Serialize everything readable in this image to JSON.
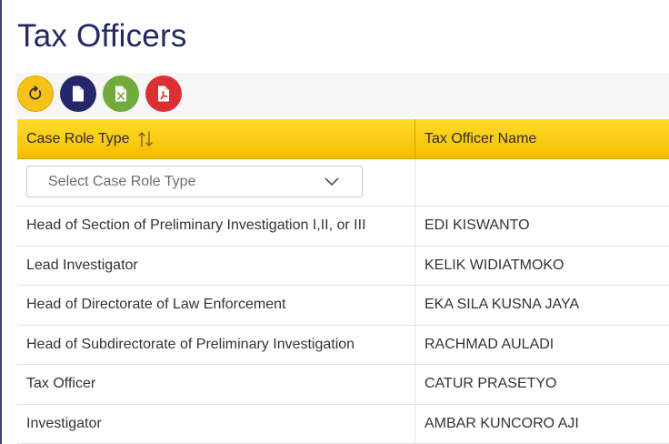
{
  "page": {
    "title": "Tax Officers"
  },
  "toolbar": {
    "buttons": [
      {
        "name": "refresh",
        "icon": "refresh-icon",
        "color": "#f7c11a"
      },
      {
        "name": "export-file",
        "icon": "file-icon",
        "color": "#23286a"
      },
      {
        "name": "export-excel",
        "icon": "excel-file-icon",
        "color": "#72aa3c"
      },
      {
        "name": "export-pdf",
        "icon": "pdf-file-icon",
        "color": "#dc2f34"
      }
    ]
  },
  "table": {
    "header_color": "#f9c80e",
    "columns": [
      {
        "label": "Case Role Type",
        "sortable": true
      },
      {
        "label": "Tax Officer Name"
      }
    ],
    "filter": {
      "case_role_type_placeholder": "Select Case Role Type"
    },
    "rows": [
      [
        "Head of Section of Preliminary Investigation I,II, or III",
        "EDI KISWANTO"
      ],
      [
        "Lead Investigator",
        "KELIK WIDIATMOKO"
      ],
      [
        "Head of Directorate of Law Enforcement",
        "EKA SILA KUSNA JAYA"
      ],
      [
        "Head of Subdirectorate of Preliminary Investigation",
        "RACHMAD AULADI"
      ],
      [
        "Tax Officer",
        "CATUR PRASETYO"
      ],
      [
        "Investigator",
        "AMBAR KUNCORO AJI"
      ]
    ]
  }
}
